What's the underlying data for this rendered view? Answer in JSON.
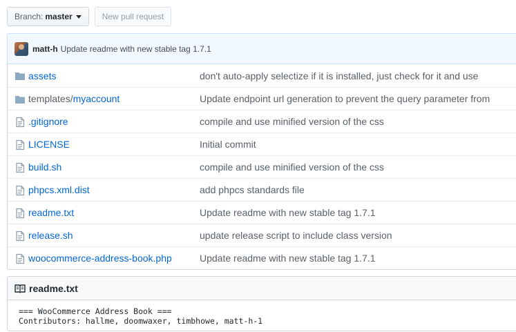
{
  "toolbar": {
    "branch_prefix": "Branch:",
    "branch_name": "master",
    "new_pr_label": "New pull request"
  },
  "latest_commit": {
    "author": "matt-h",
    "message": "Update readme with new stable tag 1.7.1"
  },
  "files": [
    {
      "type": "dir",
      "prefix": "",
      "name": "assets",
      "message": "don't auto-apply selectize if it is installed, just check for it and use"
    },
    {
      "type": "dir",
      "prefix": "templates/",
      "name": "myaccount",
      "message": "Update endpoint url generation to prevent the query parameter from"
    },
    {
      "type": "file",
      "prefix": "",
      "name": ".gitignore",
      "message": "compile and use minified version of the css"
    },
    {
      "type": "file",
      "prefix": "",
      "name": "LICENSE",
      "message": "Initial commit"
    },
    {
      "type": "file",
      "prefix": "",
      "name": "build.sh",
      "message": "compile and use minified version of the css"
    },
    {
      "type": "file",
      "prefix": "",
      "name": "phpcs.xml.dist",
      "message": "add phpcs standards file"
    },
    {
      "type": "file",
      "prefix": "",
      "name": "readme.txt",
      "message": "Update readme with new stable tag 1.7.1"
    },
    {
      "type": "file",
      "prefix": "",
      "name": "release.sh",
      "message": "update release script to include class version"
    },
    {
      "type": "file",
      "prefix": "",
      "name": "woocommerce-address-book.php",
      "message": "Update readme with new stable tag 1.7.1"
    }
  ],
  "readme": {
    "title": "readme.txt",
    "lines": [
      "=== WooCommerce Address Book ===",
      "Contributors: hallme, doomwaxer, timbhowe, matt-h-1"
    ]
  },
  "colors": {
    "link": "#0366d6",
    "icon": "#8da9c4",
    "commit_bg": "#f1f8ff"
  }
}
